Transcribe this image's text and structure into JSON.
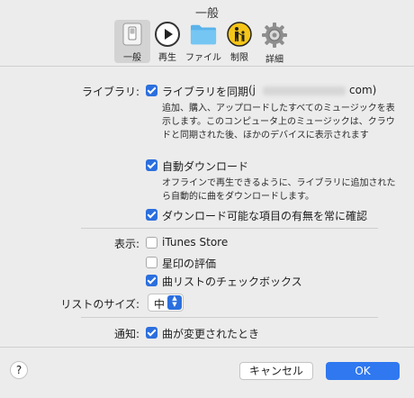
{
  "window": {
    "title": "一般"
  },
  "toolbar": {
    "tabs": [
      {
        "label": "一般",
        "icon": "switch-icon"
      },
      {
        "label": "再生",
        "icon": "play-icon"
      },
      {
        "label": "ファイル",
        "icon": "folder-icon"
      },
      {
        "label": "制限",
        "icon": "parental-icon"
      },
      {
        "label": "詳細",
        "icon": "gear-icon"
      }
    ],
    "selected": "一般"
  },
  "library": {
    "label": "ライブラリ:",
    "sync_label": "ライブラリを同期",
    "sync_checked": true,
    "account_prefix": "(j",
    "account_suffix": "com)",
    "sync_desc": "追加、購入、アップロードしたすべてのミュージックを表示します。このコンピュータ上のミュージックは、クラウドと同期された後、ほかのデバイスに表示されます",
    "auto_download_label": "自動ダウンロード",
    "auto_download_checked": true,
    "auto_download_desc": "オフラインで再生できるように、ライブラリに追加されたら自動的に曲をダウンロードします。",
    "confirm_label": "ダウンロード可能な項目の有無を常に確認",
    "confirm_checked": true
  },
  "display": {
    "label": "表示:",
    "itunes_store_label": "iTunes Store",
    "itunes_store_checked": false,
    "star_rating_label": "星印の評価",
    "star_rating_checked": false,
    "checkbox_label": "曲リストのチェックボックス",
    "checkbox_checked": true
  },
  "list_size": {
    "label": "リストのサイズ:",
    "value": "中"
  },
  "notify": {
    "label": "通知:",
    "song_change_label": "曲が変更されたとき",
    "song_change_checked": true
  },
  "footer": {
    "help": "?",
    "cancel": "キャンセル",
    "ok": "OK"
  },
  "colors": {
    "accent": "#2b6fde",
    "ok_button": "#2f78f0",
    "background": "#ececec"
  }
}
